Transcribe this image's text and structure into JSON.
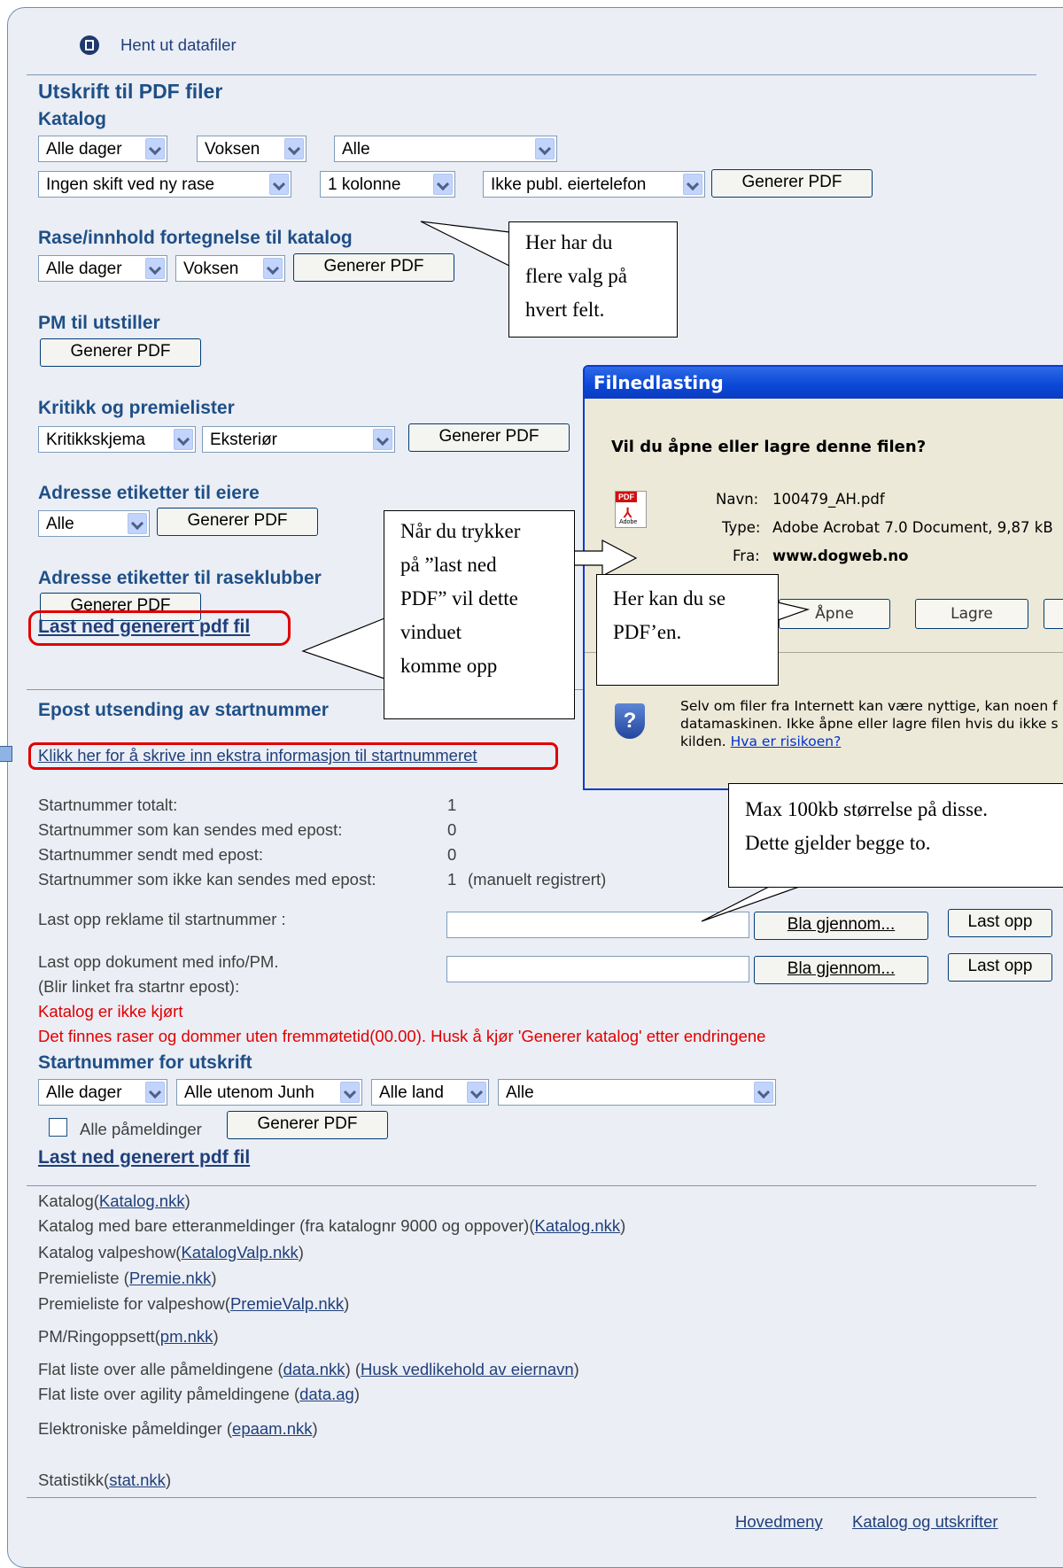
{
  "top": {
    "title": "Hent ut datafiler"
  },
  "pdf": {
    "heading": "Utskrift til PDF filer",
    "katalog": {
      "heading": "Katalog",
      "sel_days": "Alle dager",
      "sel_age": "Voksen",
      "sel_all": "Alle",
      "sel_shift": "Ingen skift ved ny rase",
      "sel_cols": "1 kolonne",
      "sel_phone": "Ikke publ. eiertelefon",
      "button": "Generer PDF"
    },
    "rase": {
      "heading": "Rase/innhold fortegnelse til katalog",
      "sel_days": "Alle dager",
      "sel_age": "Voksen",
      "button": "Generer PDF"
    },
    "pm": {
      "heading": "PM til utstiller",
      "button": "Generer PDF"
    },
    "kritikk": {
      "heading": "Kritikk og premielister",
      "sel_type": "Kritikkskjema",
      "sel_kind": "Eksteriør",
      "button": "Generer PDF"
    },
    "adr_eiere": {
      "heading": "Adresse etiketter til eiere",
      "sel": "Alle",
      "button": "Generer PDF"
    },
    "adr_klubb": {
      "heading": "Adresse etiketter til raseklubber",
      "button": "Generer PDF"
    },
    "download_link": "Last ned generert pdf fil"
  },
  "epost": {
    "heading": "Epost utsending av startnummer",
    "extra_link": "Klikk her for å skrive inn ekstra informasjon til startnummeret",
    "stats": [
      {
        "label": "Startnummer totalt:",
        "value": "1",
        "note": ""
      },
      {
        "label": "Startnummer som kan sendes med epost:",
        "value": "0",
        "note": ""
      },
      {
        "label": "Startnummer sendt med epost:",
        "value": "0",
        "note": ""
      },
      {
        "label": "Startnummer som ikke kan sendes med epost:",
        "value": "1",
        "note": "(manuelt registrert)"
      }
    ],
    "upload_ad_label": "Last opp reklame til startnummer :",
    "upload_doc_label": "Last opp dokument med info/PM.",
    "upload_doc_sub": "(Blir linket fra startnr epost):",
    "browse": "Bla gjennom...",
    "upload": "Last opp",
    "warn1": "Katalog er ikke kjørt",
    "warn2": "Det finnes raser og dommer uten fremmøtetid(00.00). Husk å kjør 'Generer katalog' etter endringene"
  },
  "startnr": {
    "heading": "Startnummer for utskrift",
    "sel_days": "Alle dager",
    "sel_junh": "Alle utenom Junh",
    "sel_land": "Alle land",
    "sel_all": "Alle",
    "checkbox": "Alle påmeldinger",
    "button": "Generer PDF",
    "download_link": "Last ned generert pdf fil"
  },
  "files": {
    "l1a": "Katalog(",
    "l1b": "Katalog.nkk",
    "l1c": ")",
    "l2a": "Katalog med bare etteranmeldinger (fra katalognr 9000 og oppover)(",
    "l2b": "Katalog.nkk",
    "l2c": ")",
    "l3a": "Katalog valpeshow(",
    "l3b": "KatalogValp.nkk",
    "l3c": ")",
    "l4a": "Premieliste (",
    "l4b": "Premie.nkk",
    "l4c": ")",
    "l5a": "Premieliste for valpeshow(",
    "l5b": "PremieValp.nkk",
    "l5c": ")",
    "l6a": "PM/Ringoppsett(",
    "l6b": "pm.nkk",
    "l6c": ")",
    "l7a": "Flat liste over alle påmeldingene (",
    "l7b": "data.nkk",
    "l7c": ")  (",
    "l7d": "Husk vedlikehold av eiernavn",
    "l7e": ")",
    "l8a": "Flat liste over agility påmeldingene (",
    "l8b": "data.ag",
    "l8c": ")",
    "l9a": "Elektroniske påmeldinger (",
    "l9b": "epaam.nkk",
    "l9c": ")",
    "l10a": "Statistikk(",
    "l10b": "stat.nkk",
    "l10c": ")"
  },
  "footer": {
    "menu": "Hovedmeny",
    "katalog": "Katalog og utskrifter"
  },
  "dialog": {
    "title": "Filnedlasting",
    "question": "Vil du åpne eller lagre denne filen?",
    "name_label": "Navn:",
    "name_value": "100479_AH.pdf",
    "type_label": "Type:",
    "type_value": "Adobe Acrobat 7.0 Document, 9,87 kB",
    "from_label": "Fra:",
    "from_value": "www.dogweb.no",
    "open": "Åpne",
    "save": "Lagre",
    "warn1": "Selv om filer fra Internett kan være nyttige, kan noen f",
    "warn2": "datamaskinen. Ikke åpne eller lagre filen hvis du ikke s",
    "warn3a": "kilden. ",
    "warn3b": "Hva er risikoen?",
    "pdf_icon_text": "PDF",
    "adobe_text": "Adobe"
  },
  "callouts": {
    "c1l1": "Her har du",
    "c1l2": "flere valg på",
    "c1l3": "hvert felt.",
    "c2l1": "Når du trykker",
    "c2l2": "på ”last ned",
    "c2l3": "PDF” vil dette",
    "c2l4": "vinduet",
    "c2l5": "komme opp",
    "c3l1": "Her kan du se",
    "c3l2": "PDF’en.",
    "c4l1": "Max 100kb størrelse på disse.",
    "c4l2": "Dette gjelder begge to."
  }
}
